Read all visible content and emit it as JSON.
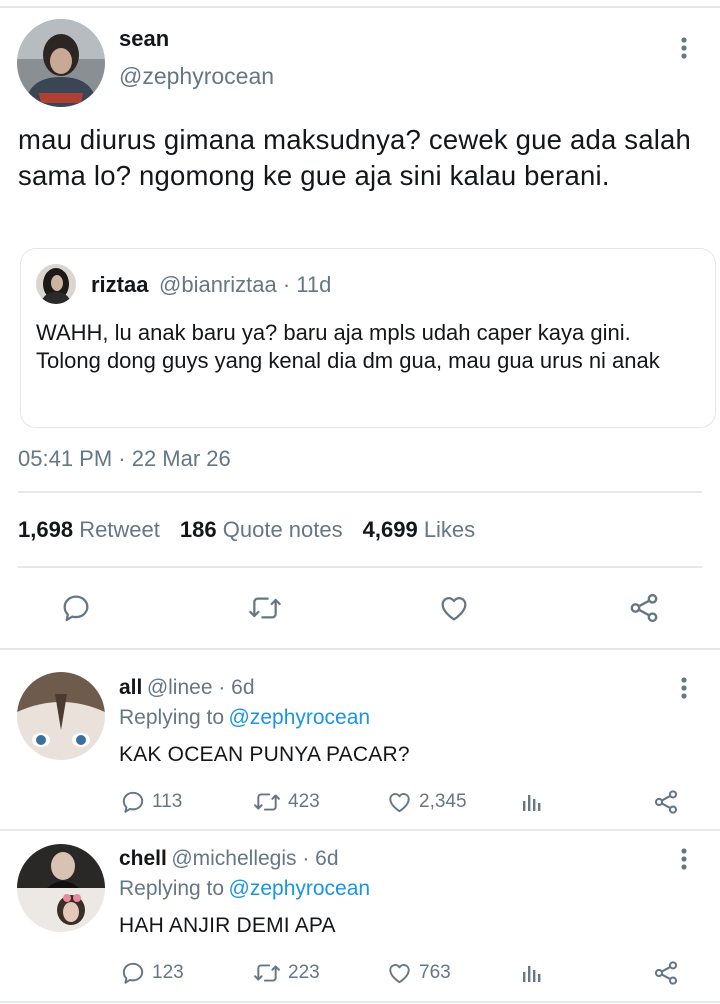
{
  "main_tweet": {
    "display_name": "sean",
    "handle": "@zephyrocean",
    "text": "mau diurus gimana maksudnya? cewek gue ada salah sama lo? ngomong ke gue aja sini kalau berani.",
    "timestamp": "05:41 PM · 22 Mar 26",
    "quoted": {
      "display_name": "riztaa",
      "meta": "@bianriztaa · 11d",
      "text": "WAHH, lu anak baru ya? baru aja mpls udah caper kaya gini. Tolong dong guys yang kenal dia dm gua, mau gua urus ni anak"
    },
    "stats": {
      "retweets_count": "1,698",
      "retweets_label": "Retweet",
      "quotes_count": "186",
      "quotes_label": "Quote notes",
      "likes_count": "4,699",
      "likes_label": "Likes"
    }
  },
  "replies": [
    {
      "display_name": "all",
      "meta": "@linee · 6d",
      "replying_prefix": "Replying to",
      "replying_handle": "@zephyrocean",
      "text": "KAK OCEAN PUNYA PACAR?",
      "reply_count": "113",
      "retweet_count": "423",
      "like_count": "2,345"
    },
    {
      "display_name": "chell",
      "meta": "@michellegis · 6d",
      "replying_prefix": "Replying to",
      "replying_handle": "@zephyrocean",
      "text": "HAH ANJIR DEMI APA",
      "reply_count": "123",
      "retweet_count": "223",
      "like_count": "763"
    }
  ],
  "colors": {
    "text_primary": "#14171a",
    "text_secondary": "#657786",
    "link": "#1b95e0",
    "divider": "#e6e9ec"
  },
  "icons": [
    "more-vertical-icon",
    "reply-icon",
    "retweet-icon",
    "like-icon",
    "share-icon",
    "analytics-icon"
  ]
}
